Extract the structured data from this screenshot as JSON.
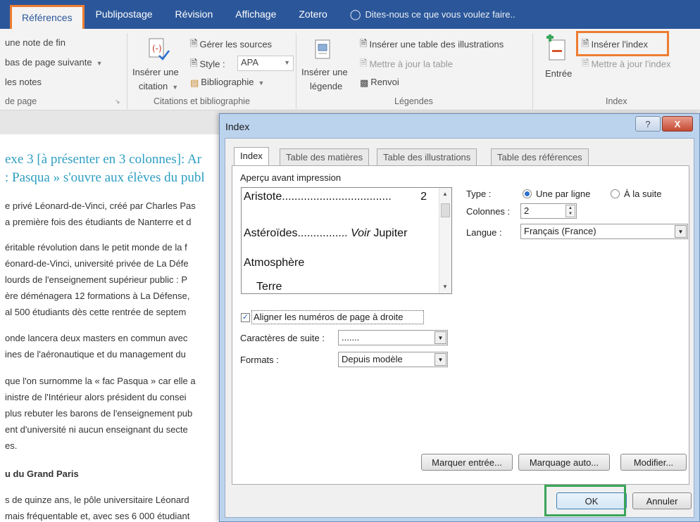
{
  "tabs": [
    {
      "label": "Références",
      "active": true
    },
    {
      "label": "Publipostage"
    },
    {
      "label": "Révision"
    },
    {
      "label": "Affichage"
    },
    {
      "label": "Zotero"
    }
  ],
  "tell_me": "Dites-nous ce que vous voulez faire..",
  "ribbon": {
    "notes": {
      "item1": "une note de fin",
      "item2": "bas de page suivante",
      "item3": "les notes",
      "group": "de page"
    },
    "citations": {
      "insert_citation_line1": "Insérer une",
      "insert_citation_line2": "citation",
      "manage_sources": "Gérer les sources",
      "style_label": "Style :",
      "style_value": "APA",
      "bibliography": "Bibliographie",
      "group": "Citations et bibliographie"
    },
    "captions": {
      "insert_caption_line1": "Insérer une",
      "insert_caption_line2": "légende",
      "insert_table_figures": "Insérer une table des illustrations",
      "update_table": "Mettre à jour la table",
      "cross_ref": "Renvoi",
      "group": "Légendes"
    },
    "index": {
      "mark_entry": "Entrée",
      "insert_index": "Insérer l'index",
      "update_index": "Mettre à jour l'index",
      "group": "Index"
    }
  },
  "document": {
    "heading1": "exe 3 [à présenter en 3 colonnes]: Ar",
    "heading2": ": Pasqua » s'ouvre aux élèves du publ",
    "lines": [
      "e privé Léonard-de-Vinci, créé par Charles Pas",
      "a première fois des étudiants de Nanterre et d",
      "éritable révolution dans le petit monde de la f",
      "éonard-de-Vinci, université privée de La Défe",
      "lourds de l'enseignement supérieur public : P",
      "ère déménagera 12 formations à La Défense,",
      "al 500 étudiants dès cette rentrée de septem",
      "onde lancera deux masters en commun avec",
      "ines de l'aéronautique et du management du",
      "que l'on surnomme la « fac Pasqua » car elle a",
      "inistre de l'Intérieur alors président du consei",
      "plus rebuter les barons de l'enseignement pub",
      "ent d'université ni aucun enseignant du secte",
      "es."
    ],
    "subheading": "u du Grand Paris",
    "lines2": [
      "s de quinze ans, le pôle universitaire Léonard",
      "mais fréquentable et, avec ses 6 000 étudiant"
    ]
  },
  "dialog": {
    "title": "Index",
    "help": "?",
    "close": "X",
    "tabs": [
      "Index",
      "Table des matières",
      "Table des illustrations",
      "Table des références"
    ],
    "preview_label": "Aperçu avant impression",
    "preview": [
      {
        "text": "Aristote",
        "leader": "...................................",
        "num": "2"
      },
      {
        "text": "Astéroïdes",
        "leader": "................",
        "see": "Voir",
        "ref": "Jupiter"
      },
      {
        "text": "Atmosphère"
      },
      {
        "text": "Terre"
      }
    ],
    "type_label": "Type :",
    "type_options": [
      "Une par ligne",
      "À la suite"
    ],
    "type_selected": 0,
    "columns_label": "Colonnes :",
    "columns_value": "2",
    "language_label": "Langue :",
    "language_value": "Français (France)",
    "align_label": "Aligner les numéros de page à droite",
    "align_checked": true,
    "tab_leader_label": "Caractères de suite :",
    "tab_leader_value": ".......",
    "formats_label": "Formats :",
    "formats_value": "Depuis modèle",
    "buttons": {
      "mark_entry": "Marquer entrée...",
      "auto_mark": "Marquage auto...",
      "modify": "Modifier...",
      "ok": "OK",
      "cancel": "Annuler"
    }
  },
  "colors": {
    "ribbon_blue": "#2b579a",
    "highlight_orange": "#ed7d31",
    "highlight_green": "#3aa55a",
    "doc_heading": "#2e9ec2"
  }
}
